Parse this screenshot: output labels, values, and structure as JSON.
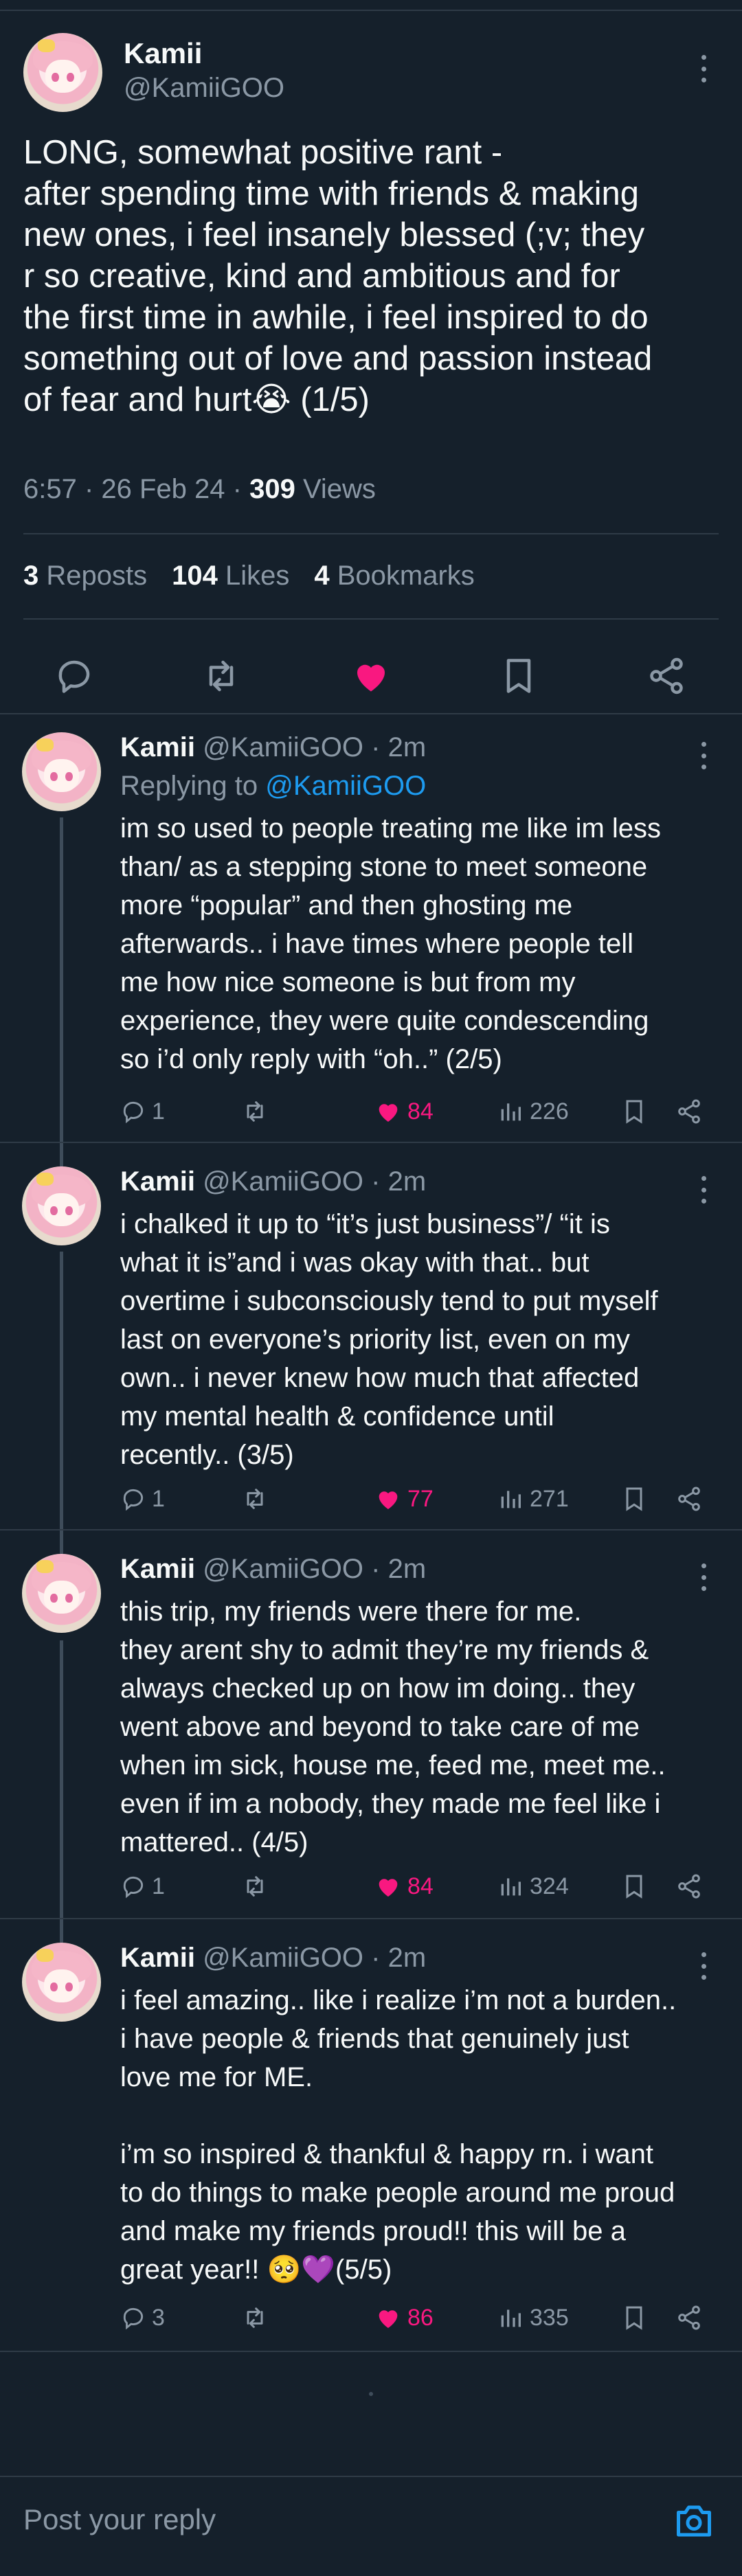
{
  "main_tweet": {
    "name": "Kamii",
    "handle": "@KamiiGOO",
    "text": "LONG, somewhat positive rant -\nafter spending time with friends & making\nnew ones, i feel insanely blessed (;v; they\nr so creative, kind and ambitious and for\nthe first time in awhile, i feel inspired to do\nsomething out of love and passion instead\nof fear and hurt😭 (1/5)",
    "time": "6:57 · 26 Feb 24 · ",
    "views_count": "309",
    "views_label": " Views",
    "reposts_count": "3",
    "reposts_label": " Reposts",
    "likes_count": "104",
    "likes_label": " Likes",
    "bookmarks_count": "4",
    "bookmarks_label": " Bookmarks"
  },
  "replies": [
    {
      "name": "Kamii",
      "handle": "@KamiiGOO",
      "time": " · 2m",
      "replying_prefix": "Replying to ",
      "replying_handle": "@KamiiGOO",
      "text": "im so used to people treating me like im less\nthan/ as a stepping stone to meet someone\nmore “popular” and then ghosting me\nafterwards.. i have times where people tell\nme how nice someone is but from my\nexperience, they were quite condescending\nso i’d only reply with “oh..” (2/5)",
      "replies": "1",
      "likes": "84",
      "views": "226"
    },
    {
      "name": "Kamii",
      "handle": "@KamiiGOO",
      "time": " · 2m",
      "text": "i chalked it up to “it’s just business”/ “it is\nwhat it is”and i was okay with that.. but\novertime i subconsciously tend to put myself\nlast on everyone’s priority list, even on my\nown.. i never knew how much that affected\nmy mental health & confidence until\nrecently.. (3/5)",
      "replies": "1",
      "likes": "77",
      "views": "271"
    },
    {
      "name": "Kamii",
      "handle": "@KamiiGOO",
      "time": " · 2m",
      "text": "this trip, my friends were there for me.\nthey arent shy to admit they’re my friends &\nalways checked up on how im doing.. they\nwent above and beyond to take care of me\nwhen im sick, house me, feed me, meet me..\neven if im a nobody, they made me feel like i\nmattered.. (4/5)",
      "replies": "1",
      "likes": "84",
      "views": "324"
    },
    {
      "name": "Kamii",
      "handle": "@KamiiGOO",
      "time": " · 2m",
      "text": "i feel amazing.. like i realize i’m not a burden..\ni have people & friends that genuinely just\nlove me for ME.\n\ni’m so inspired & thankful & happy rn. i want\nto do things to make people around me proud\nand make my friends proud!! this will be a\ngreat year!! 🥺💜(5/5)",
      "replies": "3",
      "likes": "86",
      "views": "335"
    }
  ],
  "compose": {
    "placeholder": "Post your reply"
  },
  "colors": {
    "background": "#15202b",
    "like_pink": "#f91880",
    "link_blue": "#1d9bf0",
    "muted": "#8b98a5"
  },
  "icons": [
    "reply-icon",
    "repost-icon",
    "heart-icon",
    "bookmark-icon",
    "share-icon",
    "views-icon",
    "camera-icon",
    "more-icon"
  ]
}
